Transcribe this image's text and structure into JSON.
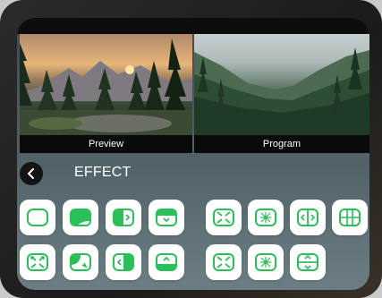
{
  "panes": {
    "preview_label": "Preview",
    "program_label": "Program"
  },
  "effect_section": {
    "title": "EFFECT",
    "back_icon": "chevron-left-icon"
  },
  "effect_buttons": [
    {
      "icon": "rounded-frame-icon"
    },
    {
      "icon": "corner-fill-icon"
    },
    {
      "icon": "split-arrow-right-icon"
    },
    {
      "icon": "slide-down-icon"
    },
    {
      "icon": "zoom-in-corners-icon"
    },
    {
      "icon": "zoom-center-icon"
    },
    {
      "icon": "split-horizontal-icon"
    },
    {
      "icon": "split-quad-icon"
    },
    {
      "icon": "zoom-out-corners-icon"
    },
    {
      "icon": "wipe-corner-icon"
    },
    {
      "icon": "split-arrow-left-icon"
    },
    {
      "icon": "slide-up-icon"
    },
    {
      "icon": "zoom-in-corners-icon"
    },
    {
      "icon": "zoom-center-icon"
    },
    {
      "icon": "split-vertical-icon"
    }
  ],
  "colors": {
    "accent_green": "#2bbf5a",
    "tile_background": "#ffffff"
  }
}
